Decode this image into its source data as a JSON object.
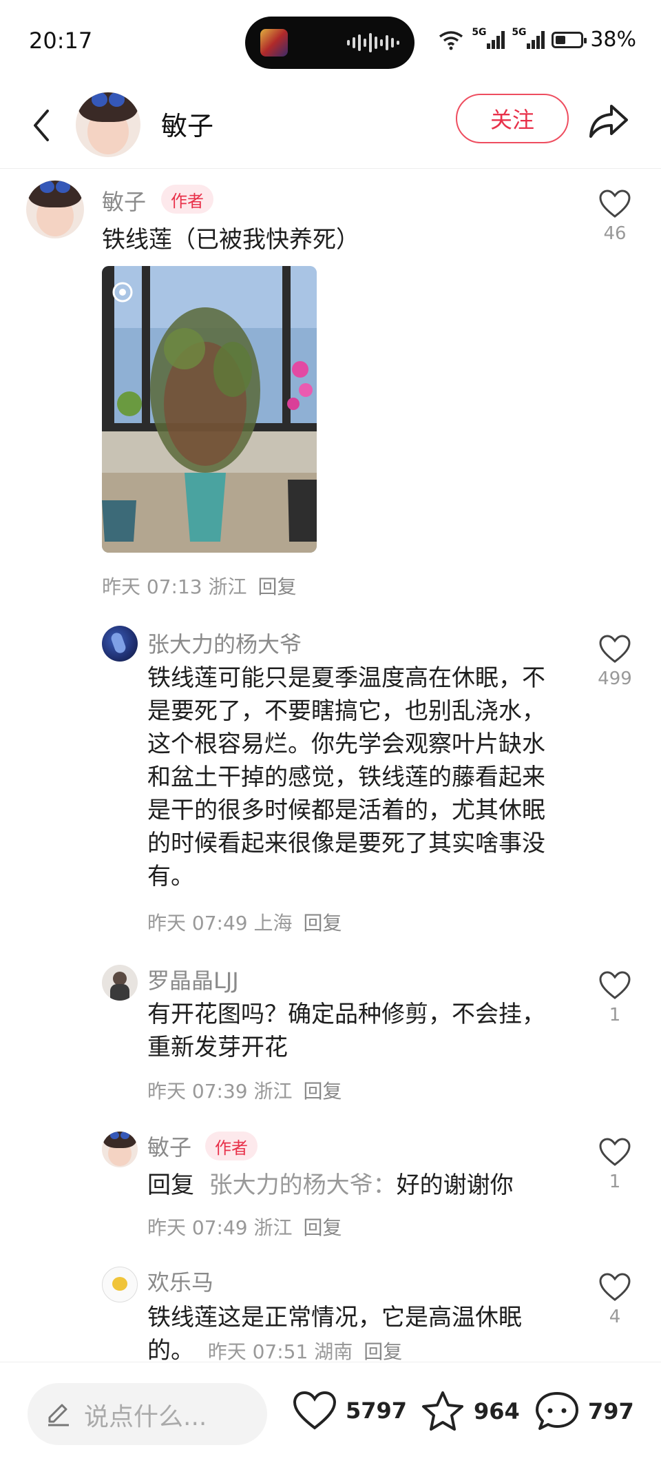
{
  "status_bar": {
    "time": "20:17",
    "network_1": "5G",
    "network_2": "5G",
    "battery": "38%"
  },
  "header": {
    "back_icon": "‹",
    "title": "敏子",
    "follow_label": "关注"
  },
  "post": {
    "author": "敏子",
    "author_tag": "作者",
    "text": "铁线莲（已被我快养死）",
    "likes": "46",
    "meta": "昨天 07:13 浙江",
    "reply_label": "回复"
  },
  "comments": [
    {
      "name": "张大力的杨大爷",
      "text": "铁线莲可能只是夏季温度高在休眠，不是要死了，不要瞎搞它，也别乱浇水，这个根容易烂。你先学会观察叶片缺水和盆土干掉的感觉，铁线莲的藤看起来是干的很多时候都是活着的，尤其休眠的时候看起来很像是要死了其实啥事没有。",
      "meta": "昨天 07:49 上海",
      "reply_label": "回复",
      "likes": "499"
    },
    {
      "name": "罗晶晶LJJ",
      "text": "有开花图吗？确定品种修剪，不会挂，重新发芽开花",
      "meta": "昨天 07:39 浙江",
      "reply_label": "回复",
      "likes": "1"
    },
    {
      "name": "敏子",
      "author_tag": "作者",
      "reply_prefix": "回复",
      "reply_to": "张大力的杨大爷：",
      "text": "好的谢谢你",
      "meta": "昨天 07:49 浙江",
      "reply_label": "回复",
      "likes": "1"
    },
    {
      "name": "欢乐马",
      "text": "铁线莲这是正常情况，它是高温休眠的。",
      "meta": "昨天 07:51 湖南",
      "reply_label": "回复",
      "likes": "4"
    }
  ],
  "bottom_bar": {
    "input_placeholder": "说点什么...",
    "like_count": "5797",
    "star_count": "964",
    "comment_count": "797"
  },
  "colors": {
    "accent": "#e8314a",
    "tag_bg": "#fde9ec",
    "meta": "#999999"
  },
  "icons": [
    "back-arrow-icon",
    "share-icon",
    "heart-icon",
    "star-icon",
    "comment-bubble-icon",
    "pen-icon"
  ]
}
